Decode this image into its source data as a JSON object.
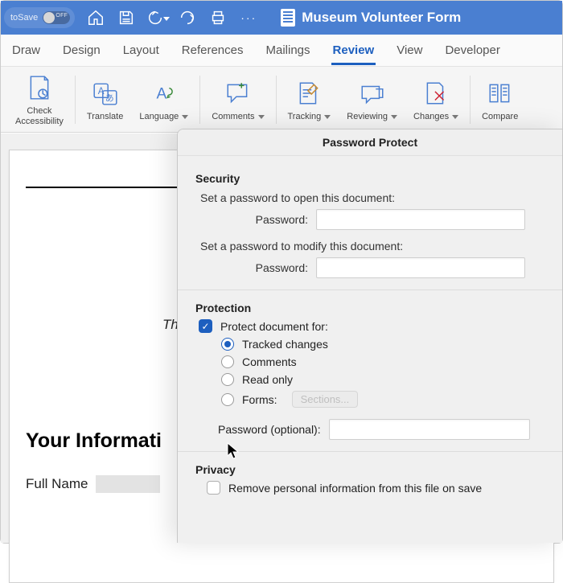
{
  "titlebar": {
    "autosave_label": "toSave",
    "document_title": "Museum Volunteer Form"
  },
  "tabs": [
    "Draw",
    "Design",
    "Layout",
    "References",
    "Mailings",
    "Review",
    "View",
    "Developer"
  ],
  "active_tab": "Review",
  "ribbon": {
    "check_accessibility": "Check\nAccessibility",
    "translate": "Translate",
    "language": "Language",
    "comments": "Comments",
    "tracking": "Tracking",
    "reviewing": "Reviewing",
    "changes": "Changes",
    "compare": "Compare"
  },
  "dialog": {
    "title": "Password Protect",
    "security_head": "Security",
    "open_label": "Set a password to open this document:",
    "password_label": "Password:",
    "modify_label": "Set a password to modify this document:",
    "protection_head": "Protection",
    "protect_doc_label": "Protect document for:",
    "opt_tracked": "Tracked changes",
    "opt_comments": "Comments",
    "opt_readonly": "Read only",
    "opt_forms": "Forms:",
    "sections_btn": "Sections...",
    "pw_optional": "Password (optional):",
    "privacy_head": "Privacy",
    "privacy_remove": "Remove personal information from this file on save",
    "protect_checked": true,
    "selected_option": "tracked"
  },
  "document": {
    "italic_prefix": "Th",
    "heading": "Your Informati",
    "fullname_label": "Full Name"
  }
}
